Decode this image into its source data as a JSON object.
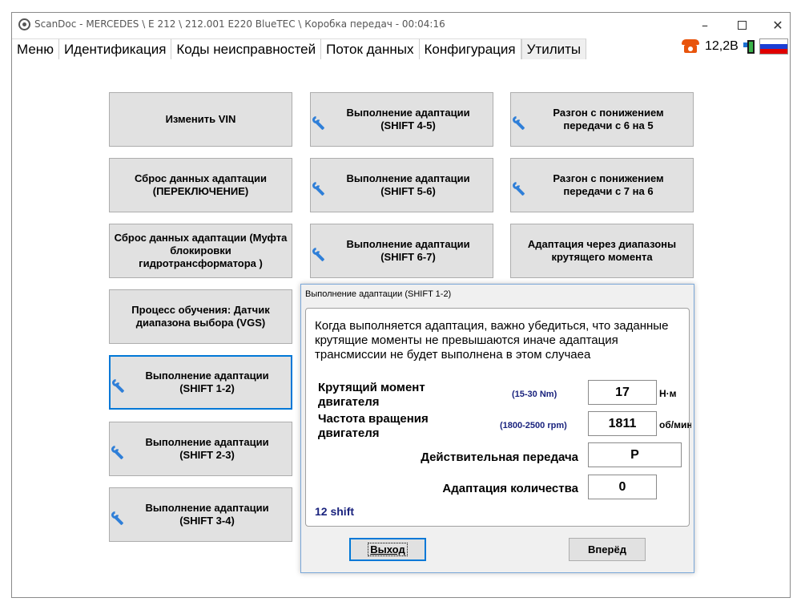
{
  "window": {
    "title": "ScanDoc - MERCEDES \\ E 212 \\ 212.001 E220 BlueTEC \\ Коробка передач - 00:04:16",
    "minimize": "–",
    "close": "✕"
  },
  "menu": {
    "items": [
      "Меню",
      "Идентификация",
      "Коды неисправностей",
      "Поток данных",
      "Конфигурация",
      "Утилиты"
    ],
    "active": "Утилиты"
  },
  "status": {
    "voltage": "12,2В",
    "flag_colors": [
      "#ffffff",
      "#1c3fd4",
      "#e00000"
    ]
  },
  "utilities": {
    "col1": [
      "Изменить VIN",
      "Сброс данных адаптации (ПЕРЕКЛЮЧЕНИЕ)",
      "Сброс данных адаптации (Муфта блокировки гидротрансформатора )",
      "Процесс обучения: Датчик диапазона выбора (VGS)",
      "Выполнение адаптации (SHIFT 1-2)",
      "Выполнение адаптации (SHIFT 2-3)",
      "Выполнение адаптации (SHIFT 3-4)"
    ],
    "col2": [
      "Выполнение адаптации (SHIFT 4-5)",
      "Выполнение адаптации (SHIFT 5-6)",
      "Выполнение адаптации (SHIFT 6-7)"
    ],
    "col3": [
      "Разгон с понижением передачи с 6 на 5",
      "Разгон с понижением передачи с 7 на 6",
      "Адаптация через диапазоны крутящего момента"
    ]
  },
  "dialog": {
    "title": "Выполнение адаптации (SHIFT 1-2)",
    "message": "Когда выполняется адаптация, важно убедиться, что заданные крутящие моменты не превышаются иначе адаптация трансмиссии не будет выполнена в этом случаеа",
    "params": {
      "torque": {
        "label": "Крутящий момент двигателя",
        "range": "(15-30 Nm)",
        "value": "17",
        "unit": "Н·м"
      },
      "speed": {
        "label": "Частота вращения двигателя",
        "range": "(1800-2500 rpm)",
        "value": "1811",
        "unit": "об/мин"
      },
      "gear": {
        "label": "Действительная передача",
        "value": "P"
      },
      "adapt": {
        "label": "Адаптация количества",
        "value": "0"
      }
    },
    "shift_label": "12 shift",
    "exit_button": "Выход",
    "next_button": "Вперёд"
  }
}
